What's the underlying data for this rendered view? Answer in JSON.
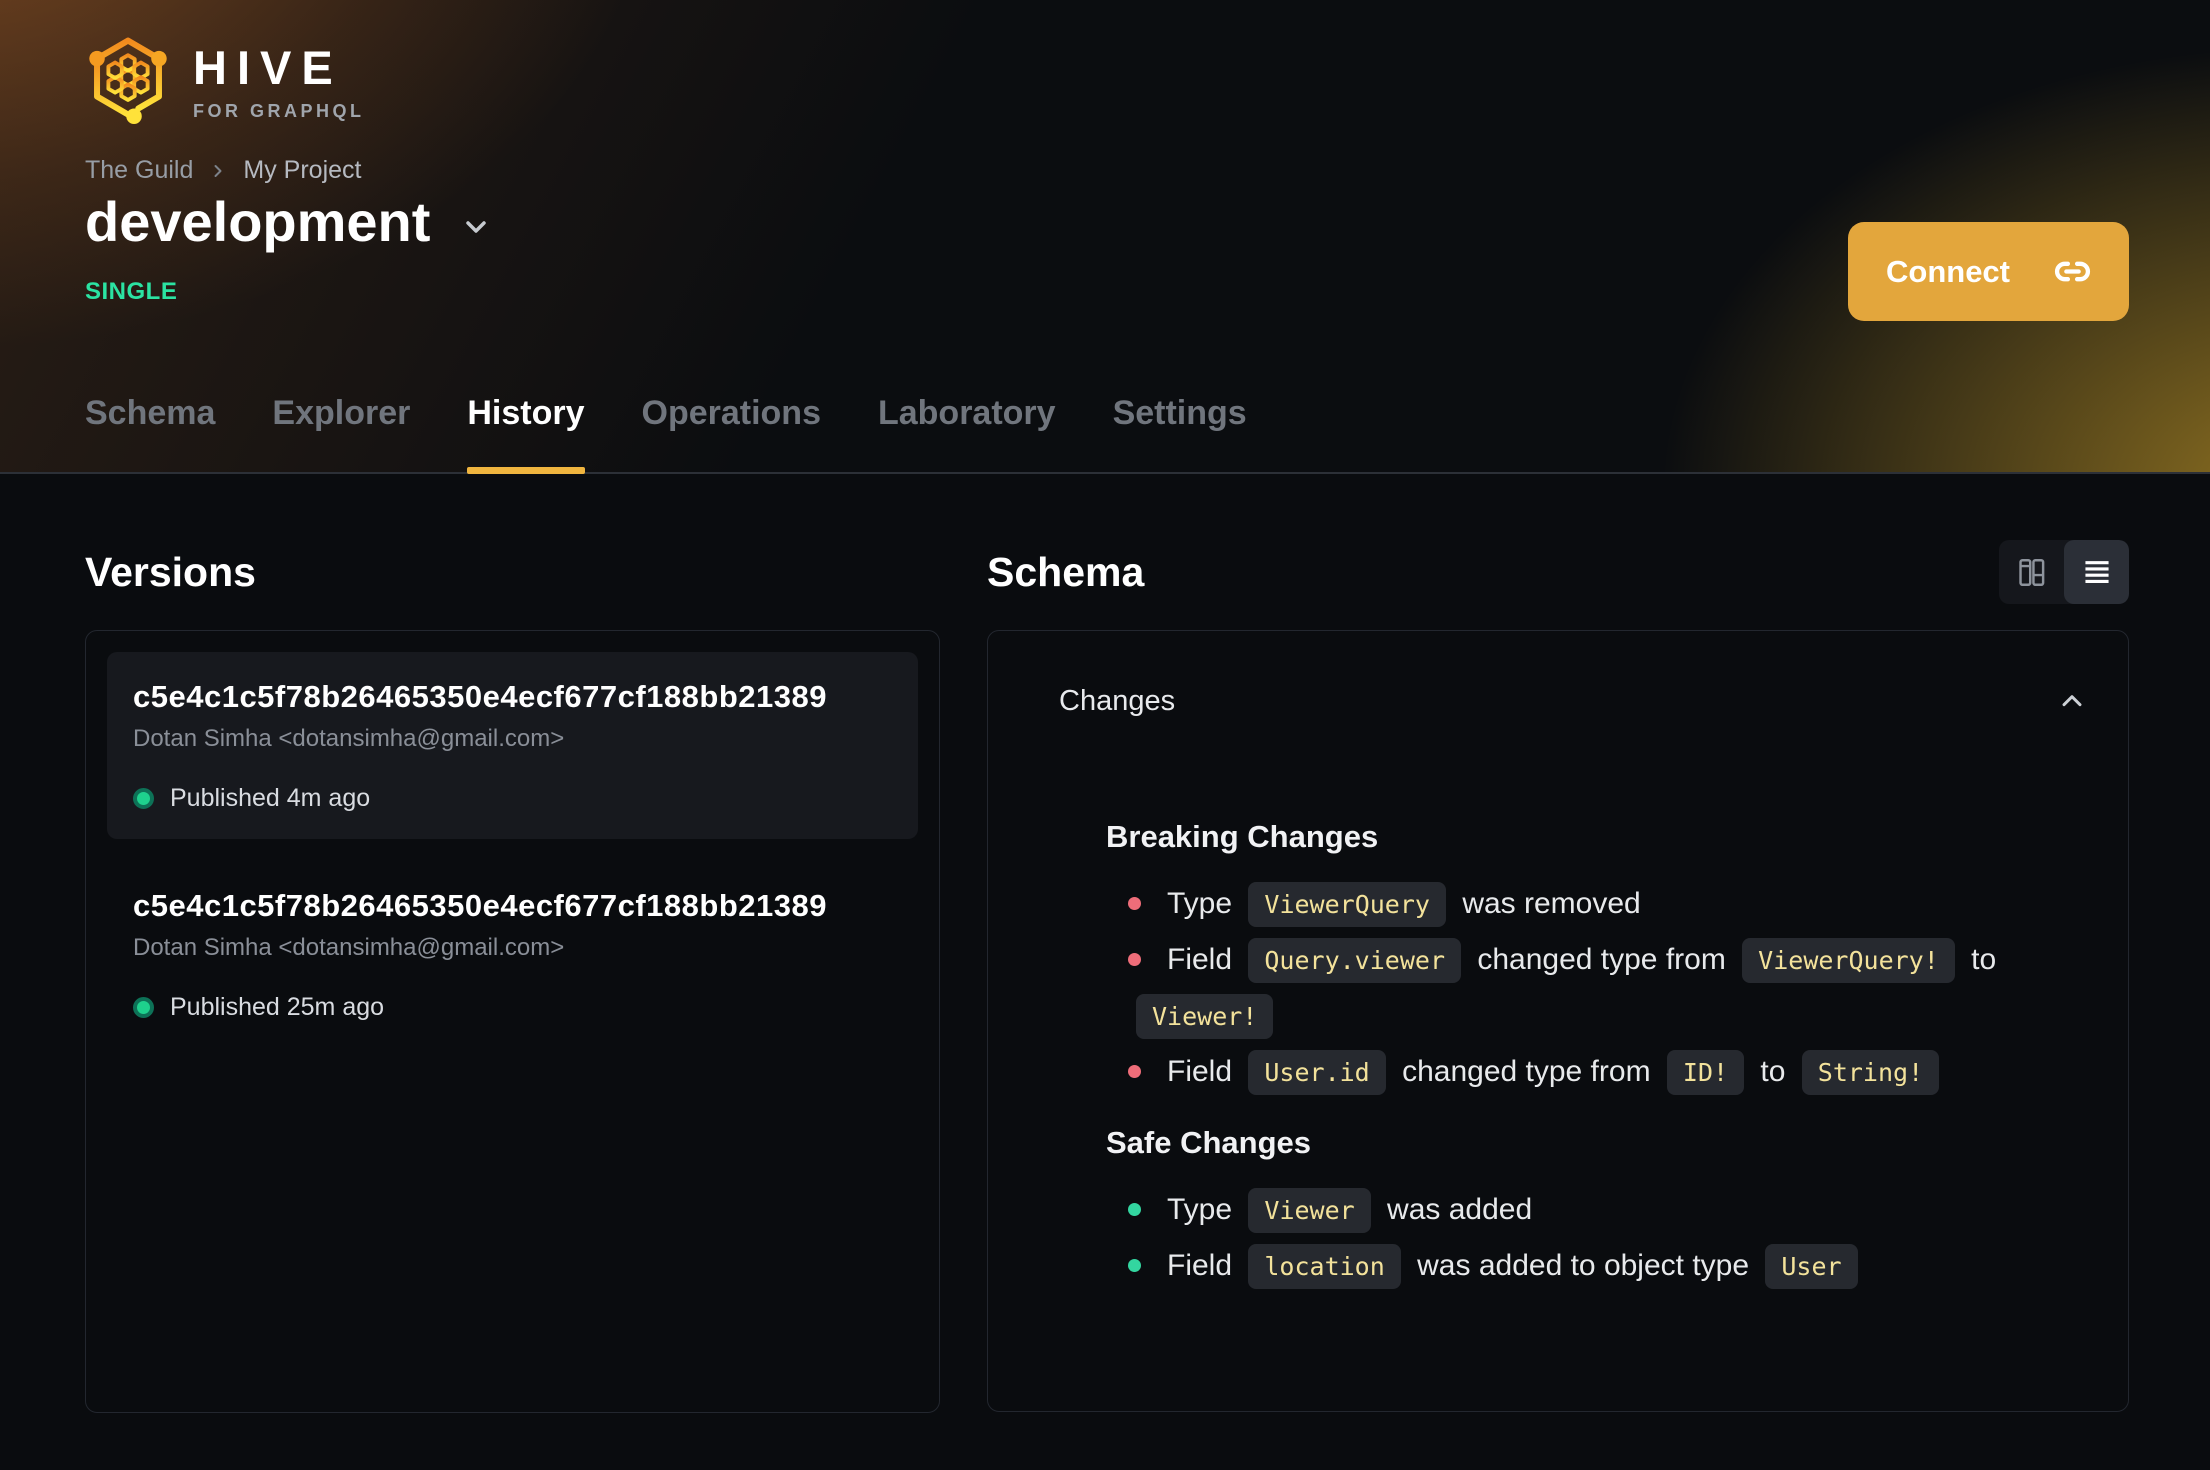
{
  "brand": {
    "name": "HIVE",
    "tagline": "FOR GRAPHQL"
  },
  "breadcrumb": {
    "items": [
      "The Guild",
      "My Project"
    ]
  },
  "project": {
    "name": "development",
    "badge": "SINGLE"
  },
  "actions": {
    "connect_label": "Connect"
  },
  "tabs": [
    {
      "label": "Schema"
    },
    {
      "label": "Explorer"
    },
    {
      "label": "History"
    },
    {
      "label": "Operations"
    },
    {
      "label": "Laboratory"
    },
    {
      "label": "Settings"
    }
  ],
  "active_tab": "History",
  "versions": {
    "heading": "Versions",
    "items": [
      {
        "hash": "c5e4c1c5f78b26465350e4ecf677cf188bb21389",
        "author": "Dotan Simha <dotansimha@gmail.com>",
        "status": "Published 4m ago"
      },
      {
        "hash": "c5e4c1c5f78b26465350e4ecf677cf188bb21389",
        "author": "Dotan Simha <dotansimha@gmail.com>",
        "status": "Published 25m ago"
      }
    ]
  },
  "schema_panel": {
    "heading": "Schema",
    "changes_title": "Changes",
    "sections": {
      "breaking": {
        "title": "Breaking Changes",
        "rows": [
          {
            "parts": [
              {
                "t": "text",
                "v": "Type"
              },
              {
                "t": "code",
                "v": "ViewerQuery"
              },
              {
                "t": "text",
                "v": "was removed"
              }
            ]
          },
          {
            "parts": [
              {
                "t": "text",
                "v": "Field"
              },
              {
                "t": "code",
                "v": "Query.viewer"
              },
              {
                "t": "text",
                "v": "changed type from"
              },
              {
                "t": "code",
                "v": "ViewerQuery!"
              },
              {
                "t": "text",
                "v": "to"
              },
              {
                "t": "code",
                "v": "Viewer!"
              }
            ]
          },
          {
            "parts": [
              {
                "t": "text",
                "v": "Field"
              },
              {
                "t": "code",
                "v": "User.id"
              },
              {
                "t": "text",
                "v": "changed type from"
              },
              {
                "t": "code",
                "v": "ID!"
              },
              {
                "t": "text",
                "v": "to"
              },
              {
                "t": "code",
                "v": "String!"
              }
            ]
          }
        ]
      },
      "safe": {
        "title": "Safe Changes",
        "rows": [
          {
            "parts": [
              {
                "t": "text",
                "v": "Type"
              },
              {
                "t": "code",
                "v": "Viewer"
              },
              {
                "t": "text",
                "v": "was added"
              }
            ]
          },
          {
            "parts": [
              {
                "t": "text",
                "v": "Field"
              },
              {
                "t": "code",
                "v": "location"
              },
              {
                "t": "text",
                "v": "was added to object type"
              },
              {
                "t": "code",
                "v": "User"
              }
            ]
          }
        ]
      }
    }
  },
  "colors": {
    "accent": "#f0b53f",
    "connect_bg": "#e3a63c",
    "badge_green": "#2be3a2",
    "breaking_bullet": "#ee6d79",
    "safe_bullet": "#33d6a0",
    "code_text": "#f3e29b"
  }
}
